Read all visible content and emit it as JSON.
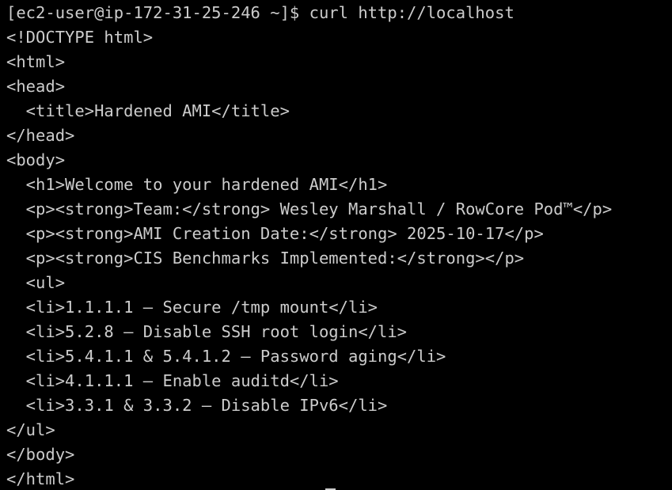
{
  "terminal": {
    "colors": {
      "background": "#000000",
      "foreground": "#cccccc"
    },
    "prompt": "[ec2-user@ip-172-31-25-246 ~]$ ",
    "command": "curl http://localhost",
    "output": [
      "<!DOCTYPE html>",
      "<html>",
      "<head>",
      "  <title>Hardened AMI</title>",
      "</head>",
      "<body>",
      "  <h1>Welcome to your hardened AMI</h1>",
      "  <p><strong>Team:</strong> Wesley Marshall / RowCore Pod™</p>",
      "  <p><strong>AMI Creation Date:</strong> 2025-10-17</p>",
      "  <p><strong>CIS Benchmarks Implemented:</strong></p>",
      "  <ul>",
      "  <li>1.1.1.1 – Secure /tmp mount</li>",
      "  <li>5.2.8 – Disable SSH root login</li>",
      "  <li>5.4.1.1 & 5.4.1.2 – Password aging</li>",
      "  <li>4.1.1.1 – Enable auditd</li>",
      "  <li>3.3.1 & 3.3.2 – Disable IPv6</li>",
      "</ul>",
      "</body>",
      "</html>"
    ]
  }
}
